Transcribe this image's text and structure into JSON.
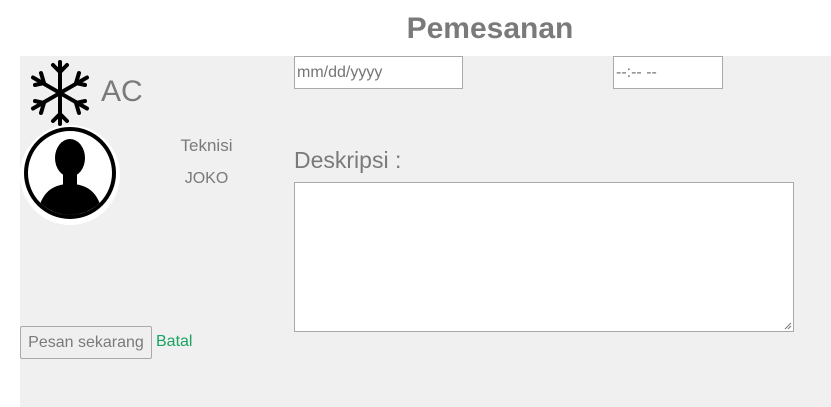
{
  "page": {
    "title": "Pemesanan"
  },
  "service": {
    "name": "AC",
    "icon": "snowflake-icon"
  },
  "technician": {
    "label": "Teknisi",
    "name": "JOKO",
    "avatar_icon": "person-silhouette-icon"
  },
  "form": {
    "date_placeholder": "mm/dd/yyyy",
    "time_placeholder": "--:-- --",
    "description_label": "Deskripsi :",
    "description_value": ""
  },
  "actions": {
    "order_label": "Pesan sekarang",
    "cancel_label": "Batal"
  },
  "colors": {
    "panel_bg": "#f0f0f0",
    "text_gray": "#7a7a7a",
    "link_green": "#1aa260"
  }
}
